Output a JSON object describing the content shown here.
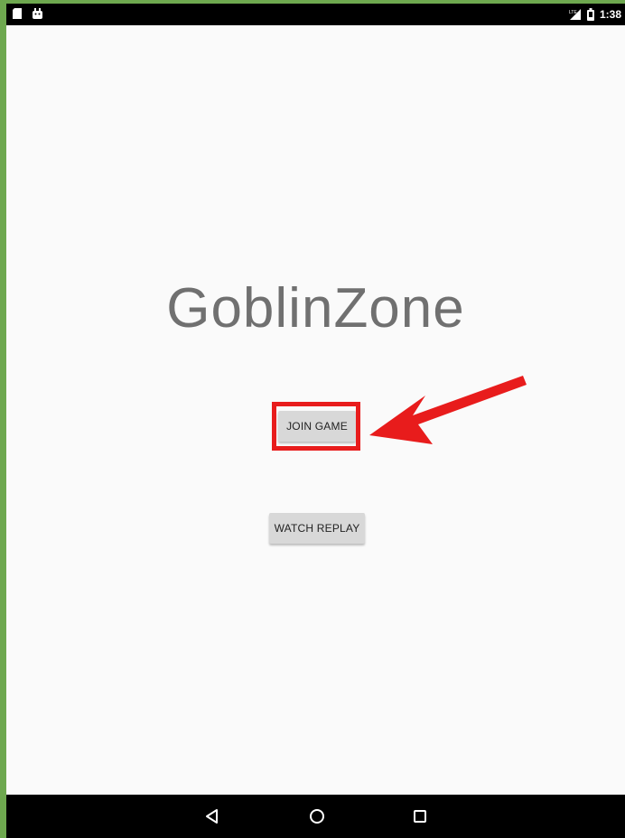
{
  "status_bar": {
    "time": "1:38",
    "left_icons": [
      "notification-icon",
      "android-icon"
    ],
    "right_icons": [
      "signal-icon",
      "battery-icon"
    ]
  },
  "app": {
    "title": "GoblinZone"
  },
  "buttons": {
    "join_game": "JOIN GAME",
    "watch_replay": "WATCH REPLAY"
  },
  "annotation": {
    "highlight_color": "#e81c1c",
    "target": "join-game-button"
  },
  "nav_bar": {
    "icons": [
      "back-icon",
      "home-icon",
      "recents-icon"
    ]
  },
  "colors": {
    "background": "#fafafa",
    "title_text": "#707070",
    "button": "#d8d8d8",
    "frame_border": "#6ea84f"
  }
}
